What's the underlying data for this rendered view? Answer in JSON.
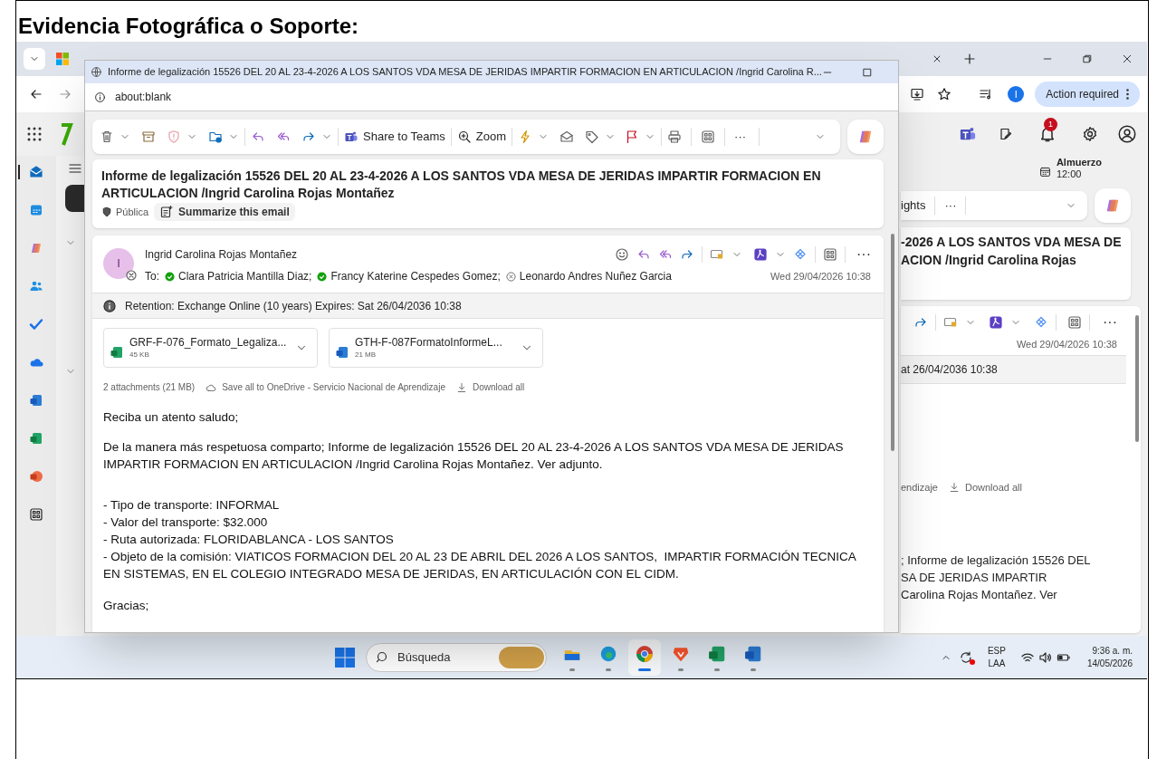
{
  "document_heading": "Evidencia Fotográfica o Soporte:",
  "browser": {
    "action_required": "Action required",
    "profile_initial": "I"
  },
  "outlook_header": {
    "notification_count": "1"
  },
  "app_rail": [
    {
      "kind": "mail",
      "selected": true
    },
    {
      "kind": "calendar",
      "selected": false
    },
    {
      "kind": "copilot",
      "selected": false
    },
    {
      "kind": "people",
      "selected": false
    },
    {
      "kind": "todo",
      "selected": false
    },
    {
      "kind": "onedrive",
      "selected": false
    },
    {
      "kind": "word",
      "selected": false
    },
    {
      "kind": "excel",
      "selected": false
    },
    {
      "kind": "powerpoint",
      "selected": false
    },
    {
      "kind": "apps",
      "selected": false
    }
  ],
  "calendar_reminder": {
    "title": "Almuerzo",
    "time": "12:00"
  },
  "background_toolbar": {
    "button_fragment": "ights",
    "more": "···"
  },
  "background_reading_pane": {
    "more": "···",
    "subject_fragments": [
      "-2026 A LOS SANTOS VDA MESA DE",
      "ACION /Ingrid Carolina Rojas"
    ],
    "date": "Wed 29/04/2026 10:38",
    "retention_fragment": "at 26/04/2036 10:38",
    "save_fragment": "endizaje",
    "download_all": "Download all",
    "body_fragments": [
      "; Informe de legalización 15526 DEL",
      "SA DE JERIDAS IMPARTIR",
      "Carolina Rojas Montañez. Ver"
    ]
  },
  "popup": {
    "title": "Informe de legalización 15526 DEL 20 AL 23-4-2026 A LOS SANTOS VDA MESA DE JERIDAS IMPARTIR FORMACION EN ARTICULACION /Ingrid Carolina R...",
    "address": "about:blank",
    "toolbar": {
      "share": "Share to Teams",
      "zoom": "Zoom",
      "more": "···"
    },
    "subject": "Informe de legalización 15526 DEL 20 AL 23-4-2026 A LOS SANTOS VDA MESA DE JERIDAS IMPARTIR FORMACION EN ARTICULACION /Ingrid Carolina Rojas Montañez",
    "sensitivity": "Pública",
    "summarize": "Summarize this email",
    "sender": {
      "name": "Ingrid Carolina Rojas Montañez",
      "initial": "I"
    },
    "message_more": "···",
    "to_label": "To:",
    "recipients": [
      {
        "name": "Clara Patricia Mantilla Diaz;",
        "kind": "available"
      },
      {
        "name": "Francy Katerine Cespedes Gomez;",
        "kind": "available"
      },
      {
        "name": "Leonardo Andres Nuñez Garcia",
        "kind": "offline"
      }
    ],
    "date": "Wed 29/04/2026 10:38",
    "retention": "Retention: Exchange Online (10 years) Expires: Sat 26/04/2036 10:38",
    "attachments": [
      {
        "kind": "excel",
        "name": "GRF-F-076_Formato_Legaliza...",
        "size": "45 KB"
      },
      {
        "kind": "word",
        "name": "GTH-F-087FormatoInformeL...",
        "size": "21 MB"
      }
    ],
    "attachment_summary": "2 attachments (21 MB)",
    "save_all": "Save all to OneDrive - Servicio Nacional de Aprendizaje",
    "download_all": "Download all",
    "body": {
      "greeting": "Reciba un atento saludo;",
      "intro": "De la manera más respetuosa comparto; Informe de legalización 15526 DEL 20 AL 23-4-2026 A LOS SANTOS VDA MESA DE JERIDAS IMPARTIR FORMACION EN ARTICULACION /Ingrid Carolina Rojas Montañez. Ver adjunto.",
      "details": [
        "- Tipo de transporte: INFORMAL",
        "- Valor del transporte: $32.000",
        "- Ruta autorizada: FLORIDABLANCA - LOS SANTOS",
        "- Objeto de la comisión: VIATICOS FORMACION DEL 20 AL 23 DE ABRIL DEL 2026 A LOS SANTOS,  IMPARTIR FORMACIÓN TECNICA EN SISTEMAS, EN EL COLEGIO INTEGRADO MESA DE JERIDAS, EN ARTICULACIÓN CON EL CIDM."
      ],
      "closing": "Gracias;"
    }
  },
  "taskbar": {
    "search_placeholder": "Búsqueda",
    "apps": [
      {
        "kind": "explorer",
        "selected": false
      },
      {
        "kind": "edge",
        "selected": false
      },
      {
        "kind": "chrome",
        "selected": true
      },
      {
        "kind": "brave",
        "selected": false
      },
      {
        "kind": "excel",
        "selected": false
      },
      {
        "kind": "word",
        "selected": false
      }
    ],
    "language": "ESP",
    "layout": "LAA",
    "time": "9:36 a. m.",
    "date": "14/05/2026"
  }
}
